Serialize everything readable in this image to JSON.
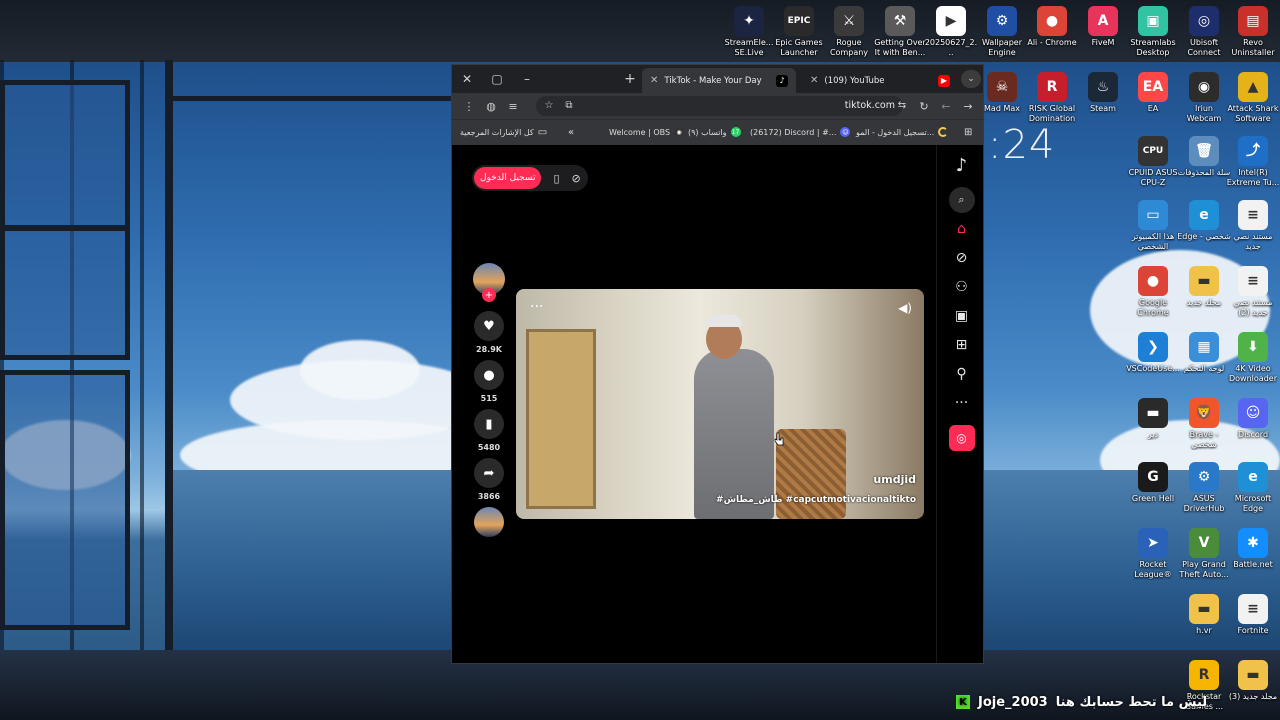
{
  "desktop": {
    "clock_fragment": ":24",
    "overlay_message": "ليش ما تحط حسابك هنا",
    "overlay_user": "Joje_2003",
    "overlay_badge": "K",
    "top_icons": [
      {
        "label": "StreamEle... SE.Live",
        "icon": "streamelements-icon",
        "color": "#1b2440",
        "glyph": "✦"
      },
      {
        "label": "Epic Games Launcher",
        "icon": "epic-games-icon",
        "color": "#2a2a2a",
        "glyph": "EPIC"
      },
      {
        "label": "Rogue Company",
        "icon": "rogue-company-icon",
        "color": "#3a3a3a",
        "glyph": "⚔"
      },
      {
        "label": "Getting Over It with Ben...",
        "icon": "hammer-icon",
        "color": "#5a5a5a",
        "glyph": "⚒"
      },
      {
        "label": "20250627_2...",
        "icon": "video-file-icon",
        "color": "#ffffff",
        "glyph": "▶"
      },
      {
        "label": "Wallpaper Engine",
        "icon": "wallpaper-engine-icon",
        "color": "#1f4ea3",
        "glyph": "⚙"
      },
      {
        "label": "Ali - Chrome",
        "icon": "chrome-icon",
        "color": "#db4437",
        "glyph": "●"
      },
      {
        "label": "FiveM",
        "icon": "fivem-icon",
        "color": "#e8335b",
        "glyph": "A"
      },
      {
        "label": "Streamlabs Desktop",
        "icon": "streamlabs-icon",
        "color": "#31c3a2",
        "glyph": "▣"
      },
      {
        "label": "Ubisoft Connect",
        "icon": "ubisoft-icon",
        "color": "#1e2d6b",
        "glyph": "◎"
      },
      {
        "label": "Revo Uninstaller",
        "icon": "revo-uninstaller-icon",
        "color": "#c9302c",
        "glyph": "▤"
      }
    ],
    "right_icons": [
      {
        "label": "Mad Max",
        "icon": "mad-max-icon",
        "color": "#6b2a1f",
        "glyph": "☠"
      },
      {
        "label": "RISK Global Domination",
        "icon": "risk-icon",
        "color": "#c61e2b",
        "glyph": "R"
      },
      {
        "label": "Steam",
        "icon": "steam-icon",
        "color": "#1b2838",
        "glyph": "♨"
      },
      {
        "label": "EA",
        "icon": "ea-icon",
        "color": "#ff4747",
        "glyph": "EA"
      },
      {
        "label": "Iriun Webcam",
        "icon": "webcam-icon",
        "color": "#2c2c2c",
        "glyph": "◉"
      },
      {
        "label": "Attack Shark Software",
        "icon": "attack-shark-icon",
        "color": "#e6b21a",
        "glyph": "▲"
      },
      {
        "label": "CPUID ASUS CPU-Z",
        "icon": "cpu-z-icon",
        "color": "#333333",
        "glyph": "CPU"
      },
      {
        "label": "سلة المحذوفات",
        "icon": "recycle-bin-icon",
        "color": "#5c8dbd",
        "glyph": "🗑"
      },
      {
        "label": "Intel(R) Extreme Tu...",
        "icon": "intel-xtu-icon",
        "color": "#1f6fc7",
        "glyph": "⤴"
      },
      {
        "label": "هذا الكمبيوتر الشخصي",
        "icon": "this-pc-icon",
        "color": "#2f8ad6",
        "glyph": "▭"
      },
      {
        "label": "Edge - شخصي",
        "icon": "edge-icon",
        "color": "#1f8fd6",
        "glyph": "e"
      },
      {
        "label": "مستند نصي جديد",
        "icon": "text-document-icon",
        "color": "#f2f2f2",
        "glyph": "≡"
      },
      {
        "label": "Google Chrome",
        "icon": "chrome-icon",
        "color": "#db4437",
        "glyph": "●"
      },
      {
        "label": "مجلد جديد",
        "icon": "folder-icon",
        "color": "#f0c24a",
        "glyph": "▬"
      },
      {
        "label": "مستند نصي جديد (2)",
        "icon": "text-document-icon",
        "color": "#f2f2f2",
        "glyph": "≡"
      },
      {
        "label": "VSCodeUse...",
        "icon": "vscode-icon",
        "color": "#1e7fd6",
        "glyph": "❯"
      },
      {
        "label": "لوحة التحكم",
        "icon": "control-panel-icon",
        "color": "#3a8fd8",
        "glyph": "▦"
      },
      {
        "label": "4K Video Downloader+",
        "icon": "4k-downloader-icon",
        "color": "#4fb34a",
        "glyph": "⬇"
      },
      {
        "label": "دير",
        "icon": "folder-icon",
        "color": "#2a2a2a",
        "glyph": "▬"
      },
      {
        "label": "Brave - شخصي",
        "icon": "brave-icon",
        "color": "#f1562b",
        "glyph": "🦁"
      },
      {
        "label": "Discord",
        "icon": "discord-icon",
        "color": "#5865f2",
        "glyph": "☺"
      },
      {
        "label": "Green Hell",
        "icon": "green-hell-icon",
        "color": "#1a1a1a",
        "glyph": "G"
      },
      {
        "label": "ASUS DriverHub",
        "icon": "asus-driverhub-icon",
        "color": "#2a78c8",
        "glyph": "⚙"
      },
      {
        "label": "Microsoft Edge",
        "icon": "edge-icon",
        "color": "#1f8fd6",
        "glyph": "e"
      },
      {
        "label": "Rocket League®",
        "icon": "rocket-league-icon",
        "color": "#2a62b8",
        "glyph": "➤"
      },
      {
        "label": "Play Grand Theft Auto...",
        "icon": "gta-icon",
        "color": "#4a8c3a",
        "glyph": "V"
      },
      {
        "label": "Battle.net",
        "icon": "battlenet-icon",
        "color": "#148eff",
        "glyph": "✱"
      },
      {
        "label": "h.vr",
        "icon": "folder-icon",
        "color": "#f0c24a",
        "glyph": "▬"
      },
      {
        "label": "Fortnite",
        "icon": "document-icon",
        "color": "#f2f2f2",
        "glyph": "≡"
      },
      {
        "label": "Rockstar Games ...",
        "icon": "rockstar-icon",
        "color": "#f7b500",
        "glyph": "R"
      },
      {
        "label": "مجلد جديد (3)",
        "icon": "folder-icon",
        "color": "#f0c24a",
        "glyph": "▬"
      }
    ]
  },
  "browser": {
    "tabs": [
      {
        "label": "TikTok - Make Your Day",
        "icon": "tiktok-icon",
        "active": true
      },
      {
        "label": "(109) YouTube",
        "icon": "youtube-icon",
        "active": false
      }
    ],
    "url": "tiktok.com",
    "bookmarks": {
      "all_bookmarks": "كل الإشارات المرجعية",
      "items": [
        {
          "label": "Welcome | OBS",
          "icon": "obs-icon",
          "color": "#333333"
        },
        {
          "label": "(٩) واتساب",
          "icon": "whatsapp-icon",
          "color": "#25d366",
          "badge": "17"
        },
        {
          "label": "(26172) Discord | #...",
          "icon": "discord-icon",
          "color": "#5865f2"
        },
        {
          "label": "تسجيل الدخول - المو...",
          "icon": "loading-icon",
          "color": "#f2c94c"
        }
      ]
    }
  },
  "tiktok": {
    "login_label": "تسجيل الدخول",
    "likes": "28.9K",
    "comments": "515",
    "saves": "5480",
    "shares": "3866",
    "video_username": "umdjid",
    "video_caption": "#طاش_مطاش #capcutmotivacionaltikto"
  }
}
